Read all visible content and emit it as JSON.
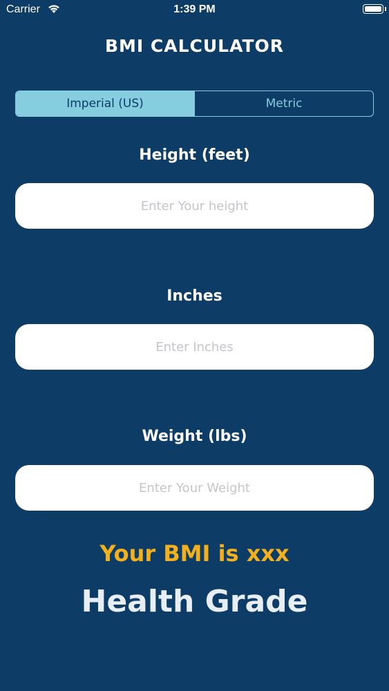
{
  "status_bar": {
    "carrier": "Carrier",
    "time": "1:39 PM",
    "wifi_icon": "wifi-icon",
    "battery_icon": "battery-icon",
    "battery_level": 1.0
  },
  "app": {
    "title": "BMI CALCULATOR"
  },
  "unit_selector": {
    "options": [
      "Imperial (US)",
      "Metric"
    ],
    "selected": "Imperial (US)"
  },
  "form": {
    "height": {
      "label": "Height (feet)",
      "placeholder": "Enter Your height",
      "value": ""
    },
    "inches": {
      "label": "Inches",
      "placeholder": "Enter Inches",
      "value": ""
    },
    "weight": {
      "label": "Weight (lbs)",
      "placeholder": "Enter Your Weight",
      "value": ""
    }
  },
  "result": {
    "bmi_text": "Your BMI is xxx",
    "grade_text": "Health Grade"
  },
  "colors": {
    "background": "#0d3c66",
    "accent": "#86cde0",
    "result": "#f2b01e",
    "field": "#ffffff"
  }
}
